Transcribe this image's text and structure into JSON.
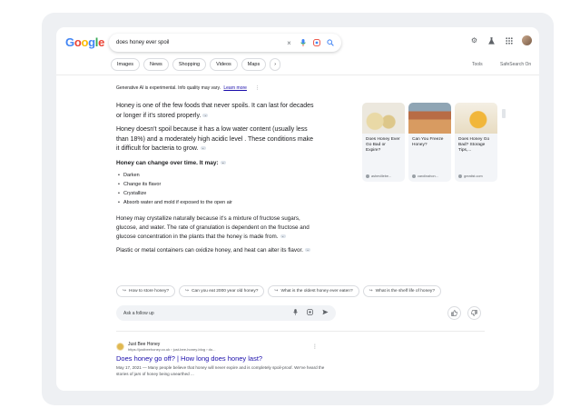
{
  "header": {
    "logo_letters": [
      "G",
      "o",
      "o",
      "g",
      "l",
      "e"
    ],
    "search_query": "does honey ever spoil"
  },
  "tabs": [
    "Images",
    "News",
    "Shopping",
    "Videos",
    "Maps"
  ],
  "tools_label": "Tools",
  "safesearch_label": "SafeSearch On",
  "ai_overview": {
    "notice": "Generative AI is experimental. Info quality may vary.",
    "learn_more": "Learn more",
    "p1": "Honey is one of the few foods that never spoils. It can last for decades or longer if it's stored properly.",
    "p2": "Honey doesn't spoil because it has a low water content (usually less than 18%) and a moderately high acidic level . These conditions make it difficult for bacteria to grow.",
    "heading": "Honey can change over time. It may:",
    "bullets": [
      "Darken",
      "Change its flavor",
      "Crystallize",
      "Absorb water and mold if exposed to the open air"
    ],
    "p3": "Honey may crystallize naturally because it's a mixture of fructose sugars, glucose, and water. The rate of granulation is dependent on the fructose and glucose concentration in the plants that the honey is made from.",
    "p4": "Plastic or metal containers can oxidize honey, and heat can alter its flavor."
  },
  "source_cards": [
    {
      "title": "Does Honey Ever Go Bad or Expire?",
      "source": "ashevillebe..."
    },
    {
      "title": "Can You Freeze Honey?",
      "source": "carolinahon..."
    },
    {
      "title": "Does Honey Go Bad? Storage Tips,...",
      "source": "greatist.com"
    }
  ],
  "followups": [
    "How to store honey?",
    "Can you eat 2000 year old honey?",
    "What is the oldest honey ever eaten?",
    "What is the shelf life of honey?"
  ],
  "ask_placeholder": "Ask a follow up",
  "result": {
    "site_name": "Just Bee Honey",
    "url": "https://justbeehoney.co.uk › just-bee-honey-blog › do...",
    "title": "Does honey go off? | How long does honey last?",
    "snippet": "May 17, 2021 — Many people believe that honey will never expire and is completely spoil-proof. We've heard the stories of jars of honey being unearthed ..."
  }
}
